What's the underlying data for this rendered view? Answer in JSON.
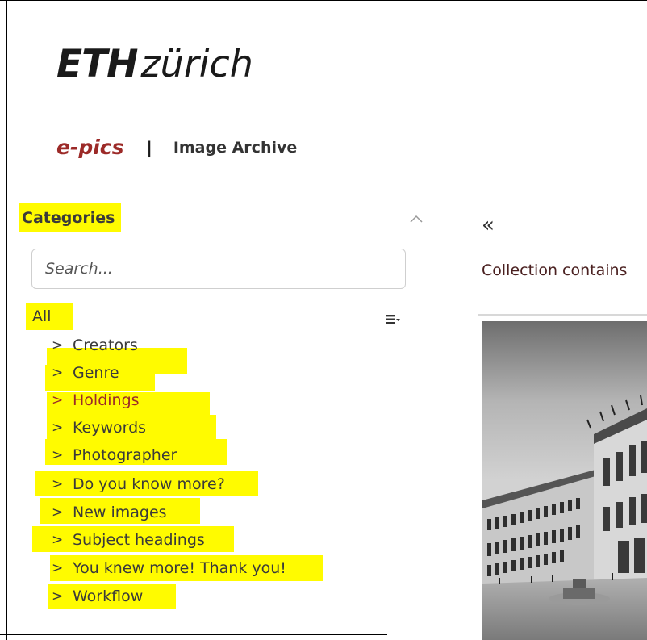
{
  "header": {
    "logo_bold": "ETH",
    "logo_light": "zürich",
    "brand_name": "e-pics",
    "brand_separator": "|",
    "brand_subtitle": "Image Archive"
  },
  "sidebar": {
    "title": "Categories",
    "search_placeholder": "Search...",
    "root_label": "All",
    "arrow": ">",
    "items": [
      {
        "label": "Creators"
      },
      {
        "label": "Genre"
      },
      {
        "label": "Holdings",
        "active": true
      },
      {
        "label": "Keywords"
      },
      {
        "label": "Photographer"
      },
      {
        "label": "Do you know more?"
      },
      {
        "label": "New images"
      },
      {
        "label": "Subject headings"
      },
      {
        "label": "You knew more! Thank you!"
      },
      {
        "label": "Workflow"
      }
    ]
  },
  "main": {
    "back_icon": "double-chevron-left-icon",
    "back_glyph": "«",
    "collection_text": "Collection contains"
  },
  "colors": {
    "brand_red": "#9c2a28",
    "highlight": "#fffb00"
  }
}
